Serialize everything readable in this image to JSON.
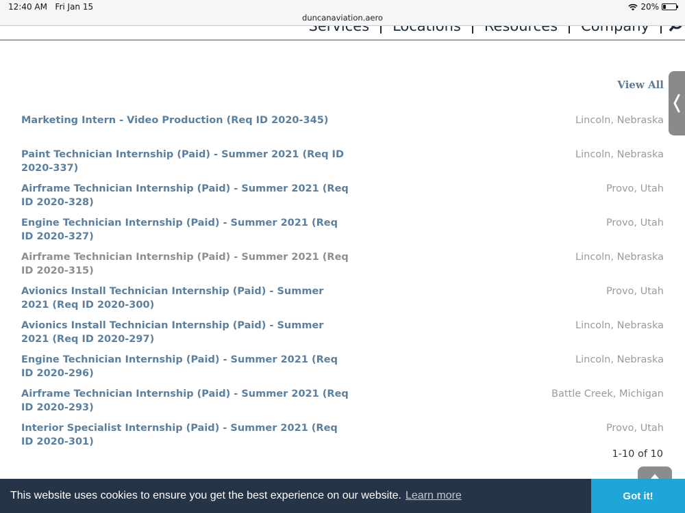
{
  "status_bar": {
    "time": "12:40 AM",
    "date": "Fri Jan 15",
    "battery": "20%",
    "battery_level": 0.2,
    "url": "duncanaviation.aero"
  },
  "nav": {
    "items": [
      "Services",
      "Locations",
      "Resources",
      "Company"
    ],
    "search_icon": "search-icon"
  },
  "jobs": {
    "view_all_label": "View All",
    "list": [
      {
        "title": "Marketing Intern - Video Production (Req ID 2020-345)",
        "location": "Lincoln, Nebraska",
        "visited": false
      },
      {
        "title": "Paint Technician Internship (Paid) - Summer 2021 (Req ID 2020-337)",
        "location": "Lincoln, Nebraska",
        "visited": false
      },
      {
        "title": "Airframe Technician Internship (Paid) - Summer 2021 (Req ID 2020-328)",
        "location": "Provo, Utah",
        "visited": false
      },
      {
        "title": "Engine Technician Internship (Paid) - Summer 2021 (Req ID 2020-327)",
        "location": "Provo, Utah",
        "visited": false
      },
      {
        "title": "Airframe Technician Internship (Paid) - Summer 2021 (Req ID 2020-315)",
        "location": "Lincoln, Nebraska",
        "visited": true
      },
      {
        "title": "Avionics Install Technician Internship (Paid) - Summer 2021 (Req ID 2020-300)",
        "location": "Provo, Utah",
        "visited": false
      },
      {
        "title": "Avionics Install Technician Internship (Paid) - Summer 2021 (Req ID 2020-297)",
        "location": "Lincoln, Nebraska",
        "visited": false
      },
      {
        "title": "Engine Technician Internship (Paid) - Summer 2021 (Req ID 2020-296)",
        "location": "Lincoln, Nebraska",
        "visited": false
      },
      {
        "title": "Airframe Technician Internship (Paid) - Summer 2021 (Req ID 2020-293)",
        "location": "Battle Creek, Michigan",
        "visited": false
      },
      {
        "title": "Interior Specialist Internship (Paid) - Summer 2021 (Req ID 2020-301)",
        "location": "Provo, Utah",
        "visited": false
      }
    ],
    "pagination": "1-10 of 10"
  },
  "cookie": {
    "text": "This website uses cookies to ensure you get the best experience on our website.",
    "learn_more": "Learn more",
    "got_it": "Got it!"
  },
  "colors": {
    "link": "#5b7f9f",
    "visited": "#8e8e8e",
    "banner": "#263447",
    "accept": "#1ea6d8"
  }
}
